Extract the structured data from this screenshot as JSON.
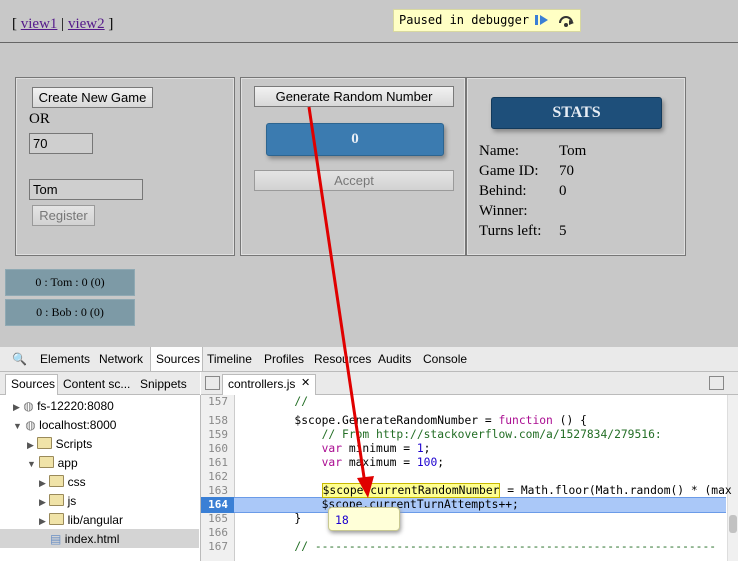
{
  "nav": {
    "open": "[",
    "view1": "view1",
    "sep": "|",
    "view2": "view2",
    "close": "]"
  },
  "debugger": {
    "paused_label": "Paused in debugger"
  },
  "left_panel": {
    "create_button": "Create New Game",
    "or_label": "OR",
    "game_id_value": "70",
    "name_value": "Tom",
    "register_button": "Register"
  },
  "middle_panel": {
    "generate_button": "Generate Random Number",
    "random_number": "0",
    "accept_button": "Accept"
  },
  "stats": {
    "title": "STATS",
    "rows": [
      {
        "label": "Name:",
        "value": "Tom"
      },
      {
        "label": "Game ID:",
        "value": "70"
      },
      {
        "label": "Behind:",
        "value": "0"
      },
      {
        "label": "Winner:",
        "value": ""
      },
      {
        "label": "Turns left:",
        "value": "5"
      }
    ]
  },
  "scores": [
    "0 : Tom : 0 (0)",
    "0 : Bob : 0 (0)"
  ],
  "devtools": {
    "tabs": [
      "Elements",
      "Network",
      "Sources",
      "Timeline",
      "Profiles",
      "Resources",
      "Audits",
      "Console"
    ],
    "active_tab": "Sources",
    "nav_tabs": [
      "Sources",
      "Content sc...",
      "Snippets"
    ],
    "file_tab": "controllers.js",
    "tree": [
      {
        "label": "fs-12220:8080"
      },
      {
        "label": "localhost:8000"
      },
      {
        "label": "Scripts"
      },
      {
        "label": "app"
      },
      {
        "label": "css"
      },
      {
        "label": "js"
      },
      {
        "label": "lib/angular"
      },
      {
        "label": "index.html"
      }
    ],
    "line_numbers": [
      "157",
      "158",
      "159",
      "160",
      "161",
      "162",
      "163",
      "164",
      "165",
      "166",
      "167"
    ],
    "current_line": "164",
    "code": {
      "l157": "        //",
      "l158_a": "        $scope.GenerateRandomNumber = ",
      "l158_kw": "function",
      "l158_b": " () {",
      "l159": "            // From http://stackoverflow.com/a/1527834/279516:",
      "l160_kw": "var",
      "l160_a": " minimum = ",
      "l160_n": "1",
      "l160_b": ";",
      "l161_kw": "var",
      "l161_a": " maximum = ",
      "l161_n": "100",
      "l161_b": ";",
      "l163_hl": "$scope.currentRandomNumber",
      "l163_rest": " = Math.floor(Math.random() * (max",
      "l164_a": "$scope.",
      "l164_b": "currentTurnAttempts++;",
      "l165": "        }",
      "l167": "        // -----------------------------------------------------------"
    },
    "hover_value": "18"
  },
  "colors": {
    "stats_button": "#1e4f7a",
    "number_box": "#3b7bb0",
    "exec_line": "#aac8f8",
    "arrow": "#e00000"
  }
}
